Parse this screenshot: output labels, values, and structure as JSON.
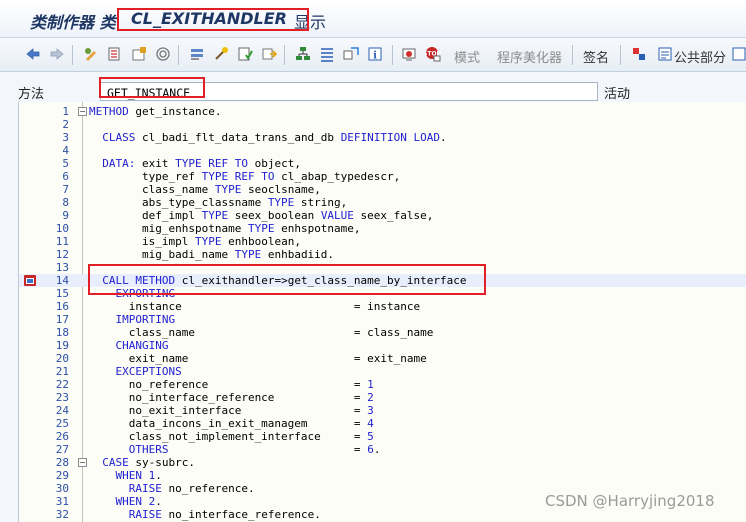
{
  "title": {
    "prefix": "类制作器 类",
    "class_name": "CL_EXITHANDLER",
    "suffix": "显示"
  },
  "toolbar": {
    "icons": [
      "back-icon",
      "forward-icon",
      "toggle-edit-icon",
      "object-list-icon",
      "display-icon",
      "where-used-icon",
      "navigate-icon",
      "activate-icon",
      "check-icon",
      "test-icon",
      "hierarchy-icon",
      "structure-icon",
      "enhance-icon",
      "info-icon",
      "stop-icon",
      "breakpoint-icon"
    ],
    "pattern_label": "模式",
    "pretty_printer_label": "程序美化器",
    "signature_label": "签名",
    "public_section_label": "公共部分"
  },
  "method_row": {
    "label": "方法",
    "value": "GET_INSTANCE",
    "status": "活动"
  },
  "editor": {
    "lines": [
      {
        "n": "1",
        "t": [
          [
            "kw",
            "METHOD"
          ],
          [
            "",
            " get_instance."
          ]
        ]
      },
      {
        "n": "2",
        "t": []
      },
      {
        "n": "3",
        "t": [
          [
            "",
            "  "
          ],
          [
            "kw",
            "CLASS"
          ],
          [
            "",
            " cl_badi_flt_data_trans_and_db "
          ],
          [
            "kw",
            "DEFINITION LOAD"
          ],
          [
            "",
            "."
          ]
        ]
      },
      {
        "n": "4",
        "t": []
      },
      {
        "n": "5",
        "t": [
          [
            "",
            "  "
          ],
          [
            "kw",
            "DATA:"
          ],
          [
            "",
            " exit "
          ],
          [
            "kw",
            "TYPE REF TO"
          ],
          [
            "",
            " object,"
          ]
        ]
      },
      {
        "n": "6",
        "t": [
          [
            "",
            "        type_ref "
          ],
          [
            "kw",
            "TYPE REF TO"
          ],
          [
            "",
            " cl_abap_typedescr,"
          ]
        ]
      },
      {
        "n": "7",
        "t": [
          [
            "",
            "        class_name "
          ],
          [
            "kw",
            "TYPE"
          ],
          [
            "",
            " seoclsname,"
          ]
        ]
      },
      {
        "n": "8",
        "t": [
          [
            "",
            "        abs_type_classname "
          ],
          [
            "kw",
            "TYPE"
          ],
          [
            "",
            " string,"
          ]
        ]
      },
      {
        "n": "9",
        "t": [
          [
            "",
            "        def_impl "
          ],
          [
            "kw",
            "TYPE"
          ],
          [
            "",
            " seex_boolean "
          ],
          [
            "kw",
            "VALUE"
          ],
          [
            "",
            " seex_false,"
          ]
        ]
      },
      {
        "n": "10",
        "t": [
          [
            "",
            "        mig_enhspotname "
          ],
          [
            "kw",
            "TYPE"
          ],
          [
            "",
            " enhspotname,"
          ]
        ]
      },
      {
        "n": "11",
        "t": [
          [
            "",
            "        is_impl "
          ],
          [
            "kw",
            "TYPE"
          ],
          [
            "",
            " enhboolean,"
          ]
        ]
      },
      {
        "n": "12",
        "t": [
          [
            "",
            "        mig_badi_name "
          ],
          [
            "kw",
            "TYPE"
          ],
          [
            "",
            " enhbadiid."
          ]
        ]
      },
      {
        "n": "13",
        "t": []
      },
      {
        "n": "14",
        "t": [
          [
            "",
            "  "
          ],
          [
            "kw",
            "CALL METHOD"
          ],
          [
            "",
            " cl_exithandler=>get_class_name_by_interface"
          ]
        ]
      },
      {
        "n": "15",
        "t": [
          [
            "",
            "    "
          ],
          [
            "kw",
            "EXPORTING"
          ]
        ]
      },
      {
        "n": "16",
        "t": [
          [
            "",
            "      instance                          = instance"
          ]
        ]
      },
      {
        "n": "17",
        "t": [
          [
            "",
            "    "
          ],
          [
            "kw",
            "IMPORTING"
          ]
        ]
      },
      {
        "n": "18",
        "t": [
          [
            "",
            "      class_name                        = class_name"
          ]
        ]
      },
      {
        "n": "19",
        "t": [
          [
            "",
            "    "
          ],
          [
            "kw",
            "CHANGING"
          ]
        ]
      },
      {
        "n": "20",
        "t": [
          [
            "",
            "      exit_name                         = exit_name"
          ]
        ]
      },
      {
        "n": "21",
        "t": [
          [
            "",
            "    "
          ],
          [
            "kw",
            "EXCEPTIONS"
          ]
        ]
      },
      {
        "n": "22",
        "t": [
          [
            "",
            "      no_reference                      = "
          ],
          [
            "kw",
            "1"
          ]
        ]
      },
      {
        "n": "23",
        "t": [
          [
            "",
            "      no_interface_reference            = "
          ],
          [
            "kw",
            "2"
          ]
        ]
      },
      {
        "n": "24",
        "t": [
          [
            "",
            "      no_exit_interface                 = "
          ],
          [
            "kw",
            "3"
          ]
        ]
      },
      {
        "n": "25",
        "t": [
          [
            "",
            "      data_incons_in_exit_managem       = "
          ],
          [
            "kw",
            "4"
          ]
        ]
      },
      {
        "n": "26",
        "t": [
          [
            "",
            "      class_not_implement_interface     = "
          ],
          [
            "kw",
            "5"
          ]
        ]
      },
      {
        "n": "27",
        "t": [
          [
            "",
            "      "
          ],
          [
            "kw",
            "OTHERS"
          ],
          [
            "",
            "                            = "
          ],
          [
            "kw",
            "6"
          ],
          [
            "",
            "."
          ]
        ]
      },
      {
        "n": "28",
        "t": [
          [
            "",
            "  "
          ],
          [
            "kw",
            "CASE"
          ],
          [
            "",
            " sy-subrc."
          ]
        ]
      },
      {
        "n": "29",
        "t": [
          [
            "",
            "    "
          ],
          [
            "kw",
            "WHEN"
          ],
          [
            "",
            " "
          ],
          [
            "kw",
            "1"
          ],
          [
            "",
            "."
          ]
        ]
      },
      {
        "n": "30",
        "t": [
          [
            "",
            "      "
          ],
          [
            "kw",
            "RAISE"
          ],
          [
            "",
            " no_reference."
          ]
        ]
      },
      {
        "n": "31",
        "t": [
          [
            "",
            "    "
          ],
          [
            "kw",
            "WHEN"
          ],
          [
            "",
            " "
          ],
          [
            "kw",
            "2"
          ],
          [
            "",
            "."
          ]
        ]
      },
      {
        "n": "32",
        "t": [
          [
            "",
            "      "
          ],
          [
            "kw",
            "RAISE"
          ],
          [
            "",
            " no_interface_reference."
          ]
        ]
      }
    ]
  },
  "watermark": "CSDN @Harryjing2018"
}
